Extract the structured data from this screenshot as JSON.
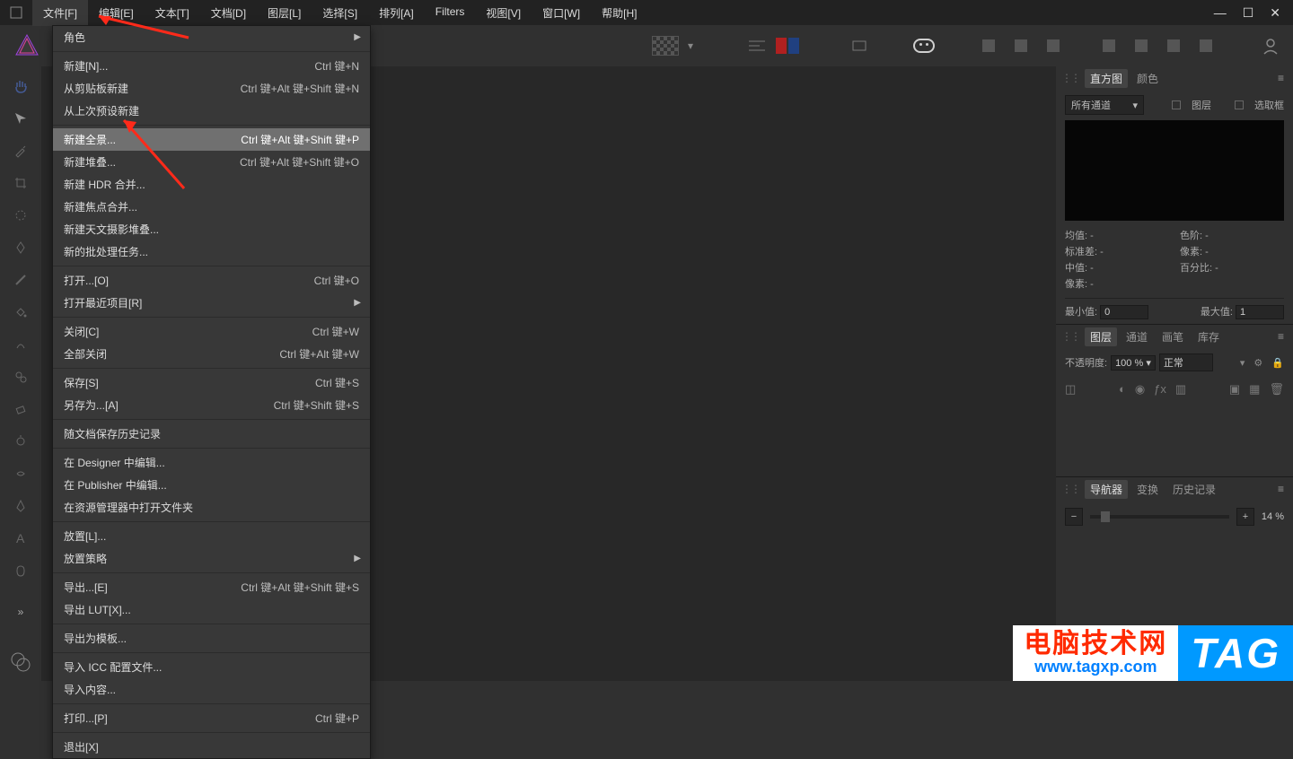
{
  "menubar": [
    "文件[F]",
    "编辑[E]",
    "文本[T]",
    "文档[D]",
    "图层[L]",
    "选择[S]",
    "排列[A]",
    "Filters",
    "视图[V]",
    "窗口[W]",
    "帮助[H]"
  ],
  "file_menu": [
    {
      "type": "sub",
      "label": "角色",
      "arrow": true
    },
    {
      "type": "sep"
    },
    {
      "type": "item",
      "label": "新建[N]...",
      "sc": "Ctrl 键+N"
    },
    {
      "type": "item",
      "label": "从剪贴板新建",
      "sc": "Ctrl 键+Alt 键+Shift 键+N"
    },
    {
      "type": "item",
      "label": "从上次预设新建",
      "sc": ""
    },
    {
      "type": "sep"
    },
    {
      "type": "item",
      "label": "新建全景...",
      "sc": "Ctrl 键+Alt 键+Shift 键+P",
      "hover": true
    },
    {
      "type": "item",
      "label": "新建堆叠...",
      "sc": "Ctrl 键+Alt 键+Shift 键+O"
    },
    {
      "type": "item",
      "label": "新建 HDR 合并..."
    },
    {
      "type": "item",
      "label": "新建焦点合并..."
    },
    {
      "type": "item",
      "label": "新建天文摄影堆叠..."
    },
    {
      "type": "item",
      "label": "新的批处理任务..."
    },
    {
      "type": "sep"
    },
    {
      "type": "item",
      "label": "打开...[O]",
      "sc": "Ctrl 键+O"
    },
    {
      "type": "sub",
      "label": "打开最近项目[R]",
      "arrow": true
    },
    {
      "type": "sep"
    },
    {
      "type": "item",
      "label": "关闭[C]",
      "sc": "Ctrl 键+W"
    },
    {
      "type": "item",
      "label": "全部关闭",
      "sc": "Ctrl 键+Alt 键+W"
    },
    {
      "type": "sep"
    },
    {
      "type": "item",
      "label": "保存[S]",
      "sc": "Ctrl 键+S"
    },
    {
      "type": "item",
      "label": "另存为...[A]",
      "sc": "Ctrl 键+Shift 键+S"
    },
    {
      "type": "sep"
    },
    {
      "type": "item",
      "label": "随文档保存历史记录"
    },
    {
      "type": "sep"
    },
    {
      "type": "item",
      "label": "在 Designer 中编辑..."
    },
    {
      "type": "item",
      "label": "在 Publisher 中编辑..."
    },
    {
      "type": "item",
      "label": "在资源管理器中打开文件夹"
    },
    {
      "type": "sep"
    },
    {
      "type": "item",
      "label": "放置[L]..."
    },
    {
      "type": "sub",
      "label": "放置策略",
      "arrow": true
    },
    {
      "type": "sep"
    },
    {
      "type": "item",
      "label": "导出...[E]",
      "sc": "Ctrl 键+Alt 键+Shift 键+S"
    },
    {
      "type": "item",
      "label": "导出 LUT[X]..."
    },
    {
      "type": "sep"
    },
    {
      "type": "item",
      "label": "导出为模板..."
    },
    {
      "type": "sep"
    },
    {
      "type": "item",
      "label": "导入 ICC 配置文件..."
    },
    {
      "type": "item",
      "label": "导入内容..."
    },
    {
      "type": "sep"
    },
    {
      "type": "item",
      "label": "打印...[P]",
      "sc": "Ctrl 键+P"
    },
    {
      "type": "sep"
    },
    {
      "type": "item",
      "label": "退出[X]"
    }
  ],
  "histogram": {
    "tabs": [
      "直方图",
      "颜色"
    ],
    "channel": "所有通道",
    "opt_layer": "图层",
    "opt_marquee": "选取框",
    "stats": {
      "mean": "均值:  -",
      "median": "中值:  -",
      "pixels": "像素:  -",
      "colorlevels": "色阶:  -",
      "pixcount": "像素:  -",
      "percent": "百分比:  -"
    },
    "min_label": "最小值:",
    "min_val": "0",
    "max_label": "最大值:",
    "max_val": "1"
  },
  "layers": {
    "tabs": [
      "图层",
      "通道",
      "画笔",
      "库存"
    ],
    "opacity_label": "不透明度:",
    "opacity_val": "100 %",
    "blend": "正常"
  },
  "navigator": {
    "tabs": [
      "导航器",
      "变换",
      "历史记录"
    ],
    "zoom": "14 %"
  },
  "watermark": {
    "cn": "电脑技术网",
    "url": "www.tagxp.com",
    "tag": "TAG"
  }
}
